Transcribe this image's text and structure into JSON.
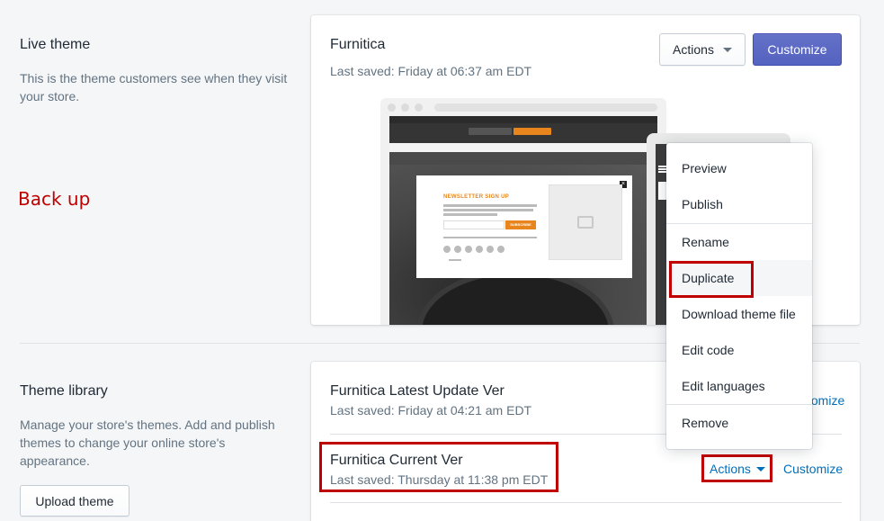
{
  "live_theme_section": {
    "title": "Live theme",
    "description": "This is the theme customers see when they visit your store."
  },
  "live_theme": {
    "name": "Furnitica",
    "last_saved": "Last saved: Friday at 06:37 am EDT",
    "actions_label": "Actions",
    "customize_label": "Customize"
  },
  "preview": {
    "popup_title": "NEWSLETTER SIGN UP",
    "popup_button": "SUBSCRIBE"
  },
  "annotation": {
    "text": "Back up",
    "color": "#c00000"
  },
  "dropdown": {
    "items": [
      {
        "label": "Preview"
      },
      {
        "label": "Publish"
      },
      {
        "label": "Rename"
      },
      {
        "label": "Duplicate"
      },
      {
        "label": "Download theme file"
      },
      {
        "label": "Edit code"
      },
      {
        "label": "Edit languages"
      },
      {
        "label": "Remove"
      }
    ]
  },
  "theme_library_section": {
    "title": "Theme library",
    "description": "Manage your store's themes. Add and publish themes to change your online store's appearance.",
    "upload_label": "Upload theme"
  },
  "theme_library": {
    "items": [
      {
        "name": "Furnitica Latest Update Ver",
        "last_saved": "Last saved: Friday at 04:21 am EDT",
        "customize_label": "stomize"
      },
      {
        "name": "Furnitica Current Ver",
        "last_saved": "Last saved: Thursday at 11:38 pm EDT",
        "actions_label": "Actions",
        "customize_label": "Customize"
      }
    ]
  },
  "colors": {
    "primary": "#5c6ac4",
    "link": "#006fbb",
    "background": "#f4f6f8",
    "annotation": "#c00000"
  }
}
